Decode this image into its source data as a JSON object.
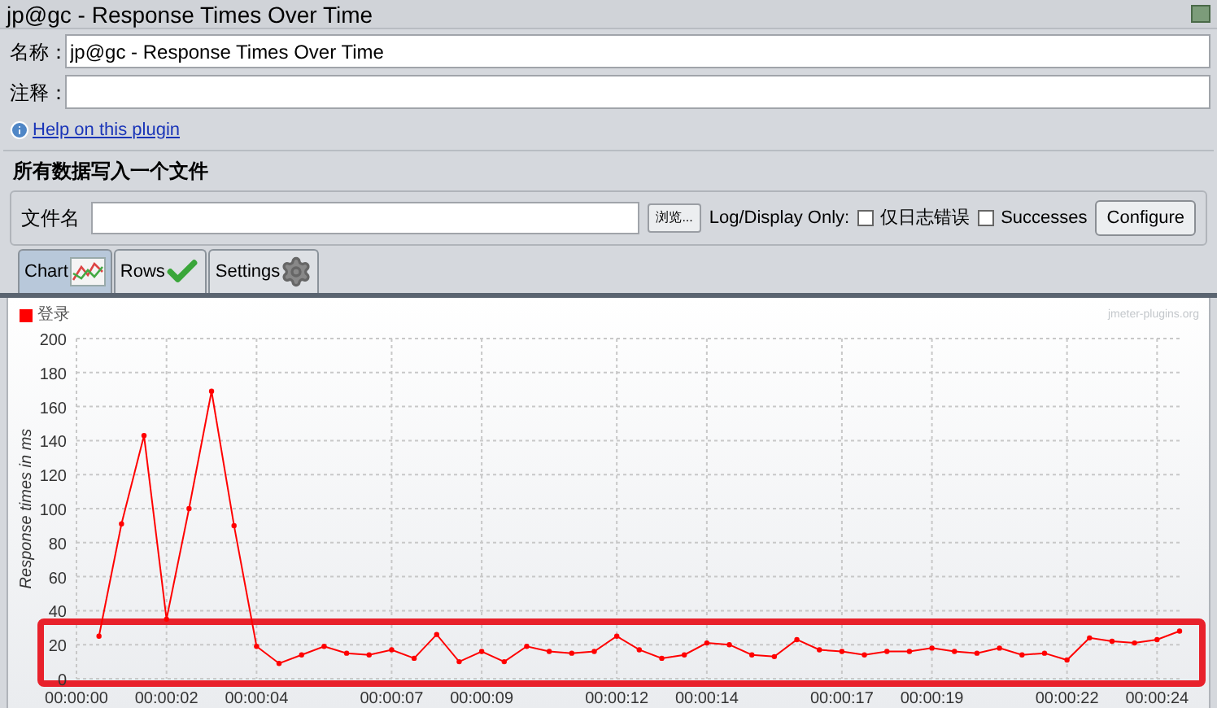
{
  "window": {
    "title": "jp@gc - Response Times Over Time"
  },
  "fields": [
    {
      "label": "名称：",
      "value": "jp@gc - Response Times Over Time"
    },
    {
      "label": "注释："
    }
  ],
  "help_link": "Help on this plugin",
  "file_section": {
    "title": "所有数据写入一个文件",
    "filename_label": "文件名",
    "browse_button": "浏览...",
    "log_display_label": "Log/Display Only:",
    "checkboxes": [
      {
        "label": "仅日志错误",
        "checked": false
      },
      {
        "label": "Successes",
        "checked": false
      }
    ],
    "configure_button": "Configure"
  },
  "tabs": [
    {
      "label": "Chart",
      "selected": true,
      "kind": "chart"
    },
    {
      "label": "Rows",
      "selected": false,
      "kind": "rows"
    },
    {
      "label": "Settings",
      "selected": false,
      "kind": "settings"
    }
  ],
  "chart": {
    "credit": "jmeter-plugins.org",
    "chart_data": {
      "type": "line",
      "ylabel": "Response times in ms",
      "xlim": [
        0,
        24.5
      ],
      "ylim": [
        0,
        200
      ],
      "yticks": [
        0,
        20,
        40,
        60,
        80,
        100,
        120,
        140,
        160,
        180,
        200
      ],
      "grid": true,
      "xticks": [
        {
          "value": 0,
          "label": "00:00:00"
        },
        {
          "value": 2,
          "label": "00:00:02"
        },
        {
          "value": 4,
          "label": "00:00:04"
        },
        {
          "value": 7,
          "label": "00:00:07"
        },
        {
          "value": 9,
          "label": "00:00:09"
        },
        {
          "value": 12,
          "label": "00:00:12"
        },
        {
          "value": 14,
          "label": "00:00:14"
        },
        {
          "value": 17,
          "label": "00:00:17"
        },
        {
          "value": 19,
          "label": "00:00:19"
        },
        {
          "value": 22,
          "label": "00:00:22"
        },
        {
          "value": 24,
          "label": "00:00:24"
        }
      ],
      "x": [
        0.5,
        1,
        1.5,
        2,
        2.5,
        3,
        3.5,
        4,
        4.5,
        5,
        5.5,
        6,
        6.5,
        7,
        7.5,
        8,
        8.5,
        9,
        9.5,
        10,
        10.5,
        11,
        11.5,
        12,
        12.5,
        13,
        13.5,
        14,
        14.5,
        15,
        15.5,
        16,
        16.5,
        17,
        17.5,
        18,
        18.5,
        19,
        19.5,
        20,
        20.5,
        21,
        21.5,
        22,
        22.5,
        23,
        23.5,
        24,
        24.5
      ],
      "series": [
        {
          "name": "登录",
          "color": "#ff0000",
          "marker": "circle",
          "values": [
            25,
            91,
            143,
            35,
            100,
            169,
            90,
            19,
            9,
            14,
            19,
            15,
            14,
            17,
            12,
            26,
            10,
            16,
            10,
            19,
            16,
            15,
            16,
            25,
            17,
            12,
            14,
            21,
            20,
            14,
            13,
            23,
            17,
            16,
            14,
            16,
            16,
            18,
            16,
            15,
            18,
            14,
            15,
            11,
            24,
            22,
            21,
            23,
            28
          ]
        }
      ]
    }
  }
}
